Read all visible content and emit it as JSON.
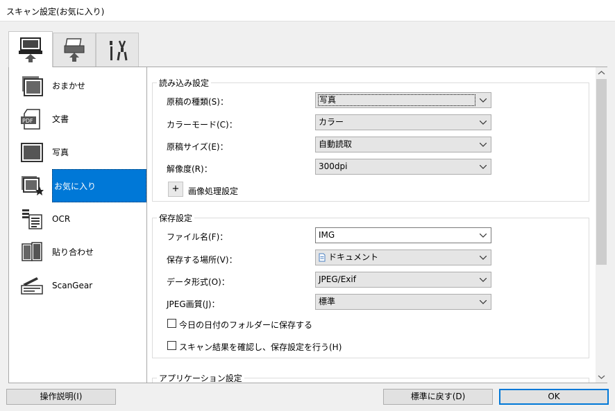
{
  "window": {
    "title": "スキャン設定(お気に入り)"
  },
  "tabs": [
    {
      "name": "scan-from-computer",
      "icon": "computer-scan-icon",
      "active": true
    },
    {
      "name": "scan-from-panel",
      "icon": "scanner-panel-icon",
      "active": false
    },
    {
      "name": "general-settings",
      "icon": "tools-icon",
      "active": false
    }
  ],
  "modes": [
    {
      "label": "おまかせ",
      "icon": "auto-scan-icon"
    },
    {
      "label": "文書",
      "icon": "pdf-document-icon"
    },
    {
      "label": "写真",
      "icon": "photo-icon"
    },
    {
      "label": "お気に入り",
      "icon": "favorite-star-icon",
      "selected": true
    },
    {
      "label": "OCR",
      "icon": "ocr-text-icon"
    },
    {
      "label": "貼り合わせ",
      "icon": "stitch-icon"
    },
    {
      "label": "ScanGear",
      "icon": "scangear-icon"
    }
  ],
  "read_settings": {
    "title": "読み込み設定",
    "doc_type_label": "原稿の種類(S)：",
    "doc_type_value": "写真",
    "color_mode_label": "カラーモード(C)：",
    "color_mode_value": "カラー",
    "paper_size_label": "原稿サイズ(E)：",
    "paper_size_value": "自動読取",
    "resolution_label": "解像度(R)：",
    "resolution_value": "300dpi",
    "image_processing_expander": "+",
    "image_processing_label": "画像処理設定"
  },
  "save_settings": {
    "title": "保存設定",
    "file_name_label": "ファイル名(F)：",
    "file_name_value": "IMG",
    "save_location_label": "保存する場所(V)：",
    "save_location_value": "ドキュメント",
    "data_format_label": "データ形式(O)：",
    "data_format_value": "JPEG/Exif",
    "jpeg_quality_label": "JPEG画質(J)：",
    "jpeg_quality_value": "標準",
    "save_today_folder_label": "今日の日付のフォルダーに保存する",
    "confirm_results_label": "スキャン結果を確認し、保存設定を行う(H)"
  },
  "app_settings": {
    "title": "アプリケーション設定"
  },
  "buttons": {
    "instructions": "操作説明(I)",
    "defaults": "標準に戻す(D)",
    "ok": "OK"
  },
  "colors": {
    "accent": "#0078d7",
    "window_bg": "#f0f0f0"
  }
}
